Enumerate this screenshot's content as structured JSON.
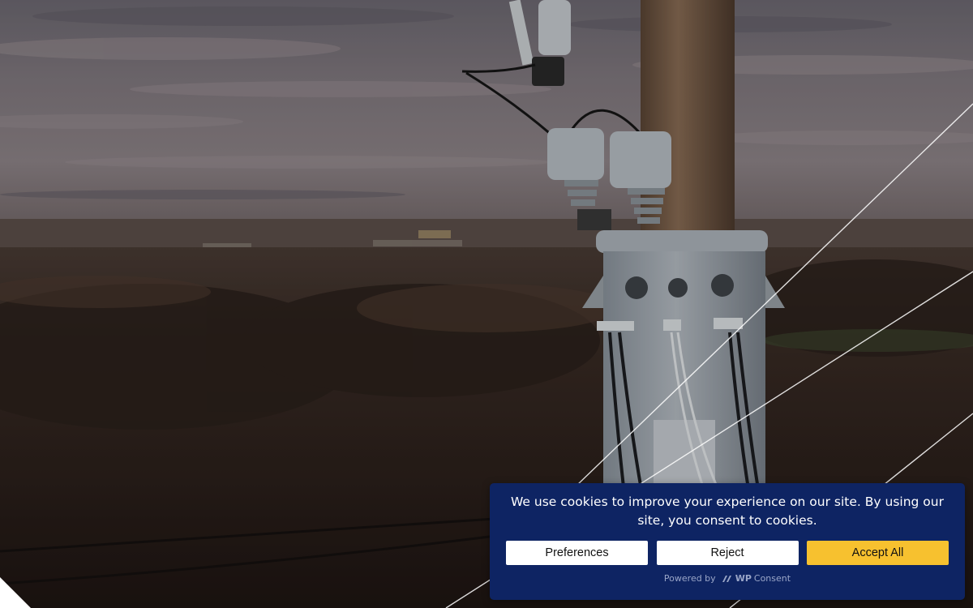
{
  "cookie_banner": {
    "message": "We use cookies to improve your experience on our site. By using our site, you consent to cookies.",
    "buttons": {
      "preferences": "Preferences",
      "reject": "Reject",
      "accept_all": "Accept All"
    },
    "powered_by": "Powered by",
    "brand_prefix": "WP",
    "brand_suffix": "Consent",
    "colors": {
      "background": "#0e2463",
      "accept_button": "#f7c12f",
      "button": "#ffffff"
    }
  },
  "icons": {
    "brand": "wpconsent-logo-icon"
  }
}
